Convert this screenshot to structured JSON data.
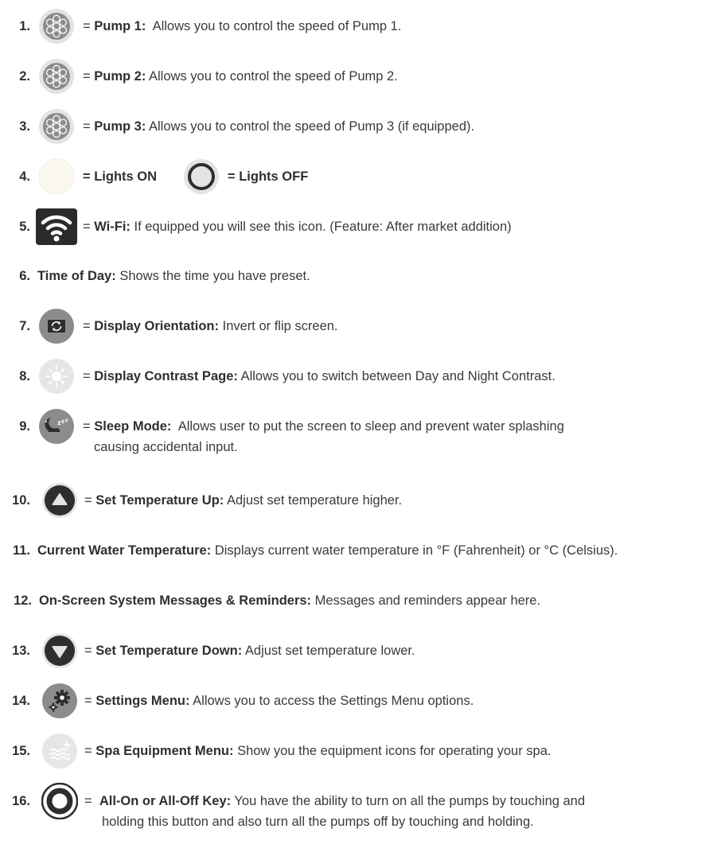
{
  "items": [
    {
      "num": "1.",
      "pre": "= ",
      "label": "Pump 1:",
      "desc": "Allows you to control the speed of Pump 1.",
      "icon": "pump-icon"
    },
    {
      "num": "2.",
      "pre": "= ",
      "label": "Pump 2:",
      "desc": "Allows you to control the speed of Pump 2.",
      "icon": "pump-icon"
    },
    {
      "num": "3.",
      "pre": "= ",
      "label": "Pump 3:",
      "desc": "Allows you to control the speed of Pump 3 (if equipped).",
      "icon": "pump-icon"
    },
    {
      "num": "4.",
      "on_label": "= Lights ON",
      "off_label": "= Lights OFF",
      "icon_on": "lights-on-icon",
      "icon_off": "lights-off-icon"
    },
    {
      "num": "5.",
      "pre": "= ",
      "label": "Wi-Fi:",
      "desc": "If equipped you will see this icon. (Feature: After market addition)",
      "icon": "wifi-icon"
    },
    {
      "num": "6.",
      "label": "Time of Day:",
      "desc": "Shows the time you have preset."
    },
    {
      "num": "7.",
      "pre": "= ",
      "label": "Display Orientation:",
      "desc": "Invert or flip screen.",
      "icon": "display-orientation-icon"
    },
    {
      "num": "8.",
      "pre": "= ",
      "label": "Display Contrast Page:",
      "desc": "Allows you to switch between Day and Night Contrast.",
      "icon": "contrast-sun-icon"
    },
    {
      "num": "9.",
      "pre": "= ",
      "label": "Sleep Mode:",
      "desc": "Allows user to put the screen to sleep and prevent water splashing",
      "cont": "causing accidental input.",
      "icon": "sleep-mode-icon"
    },
    {
      "num": "10.",
      "pre": "= ",
      "label": "Set Temperature Up:",
      "desc": "Adjust set temperature higher.",
      "icon": "temp-up-icon"
    },
    {
      "num": "11.",
      "label": "Current Water Temperature:",
      "desc": "Displays current water temperature in °F (Fahrenheit) or °C (Celsius)."
    },
    {
      "num": "12.",
      "label": "On-Screen System Messages & Reminders:",
      "desc": "Messages and reminders appear here."
    },
    {
      "num": "13.",
      "pre": "= ",
      "label": "Set Temperature Down:",
      "desc": "Adjust set temperature lower.",
      "icon": "temp-down-icon"
    },
    {
      "num": "14.",
      "pre": "= ",
      "label": "Settings Menu:",
      "desc": "Allows you to access the Settings Menu options.",
      "icon": "settings-gear-icon"
    },
    {
      "num": "15.",
      "pre": "= ",
      "label": "Spa Equipment Menu:",
      "desc": "Show you the equipment icons for operating your spa.",
      "icon": "spa-equipment-icon"
    },
    {
      "num": "16.",
      "pre": "=  ",
      "label": "All-On or All-Off Key:",
      "desc": "You have the ability to turn on all the pumps by touching and",
      "cont": "holding this button and also turn all the pumps off by touching and holding.",
      "icon": "all-on-off-icon"
    }
  ],
  "colors": {
    "text": "#3a3a3a",
    "bold": "#2f2f2f",
    "icon_dark": "#2e2e2e",
    "icon_grey": "#8c8c8c",
    "icon_light": "#e4e4e4"
  }
}
